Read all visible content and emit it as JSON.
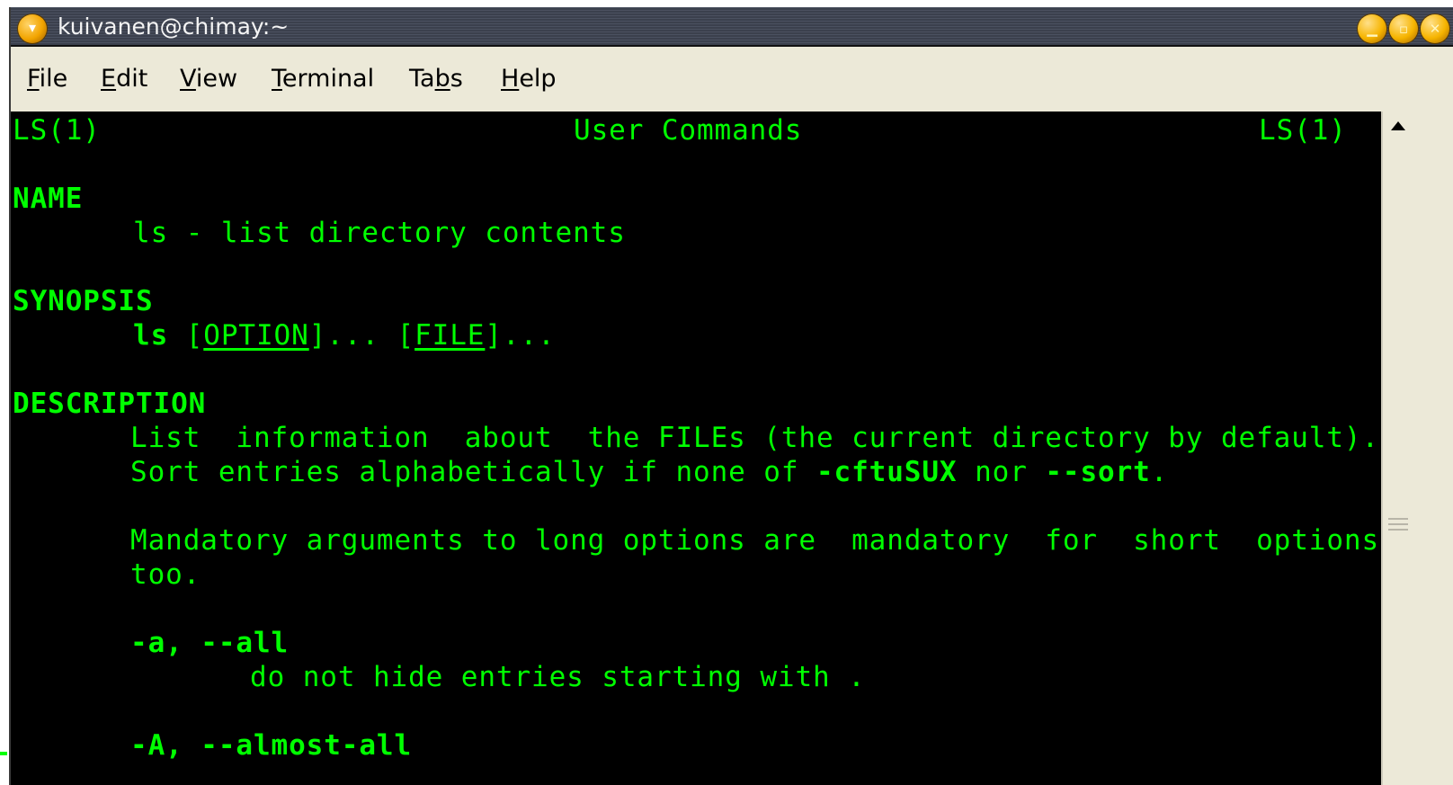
{
  "window": {
    "title": "kuivanen@chimay:~",
    "buttons": [
      "minimize",
      "maximize",
      "close"
    ]
  },
  "menubar": {
    "items": [
      {
        "label": "File",
        "mnemonic": "F"
      },
      {
        "label": "Edit",
        "mnemonic": "E"
      },
      {
        "label": "View",
        "mnemonic": "V"
      },
      {
        "label": "Terminal",
        "mnemonic": "T"
      },
      {
        "label": "Tabs",
        "mnemonic": "b"
      },
      {
        "label": "Help",
        "mnemonic": "H"
      }
    ]
  },
  "terminal": {
    "text_color": "#00ff00",
    "background": "#000000",
    "header": {
      "left": "LS(1)",
      "center": "User Commands",
      "right": "LS(1)"
    },
    "name_heading": "NAME",
    "name_text": "ls - list directory contents",
    "synopsis_heading": "SYNOPSIS",
    "synopsis": {
      "cmd": "ls",
      "open1": "[",
      "option": "OPTION",
      "close1": "]...",
      "open2": "[",
      "file": "FILE",
      "close2": "]..."
    },
    "description_heading": "DESCRIPTION",
    "desc_line1": "List  information  about  the FILEs (the current directory by default).",
    "desc_line2": {
      "before": "Sort entries alphabetically if none of ",
      "opt1": "-cftuSUX",
      "middle": " nor ",
      "opt2": "--sort",
      "after": "."
    },
    "desc_line3": "Mandatory arguments to long options are  mandatory  for  short  options",
    "desc_line4": "too.",
    "opt_a": "-a, --all",
    "opt_a_desc": "do not hide entries starting with .",
    "opt_A": "-A, --almost-all"
  },
  "icons": {
    "title": "gnome-foot-icon",
    "scroll_up": "arrow-up-icon"
  }
}
